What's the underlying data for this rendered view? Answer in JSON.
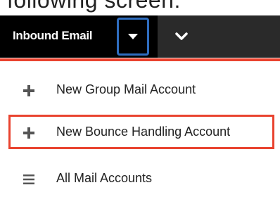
{
  "header": {
    "partial_title": "following screen:"
  },
  "navbar": {
    "module_title": "Inbound Email",
    "caret_icon": "caret-down-icon",
    "chevron_icon": "chevron-down-icon"
  },
  "menu": {
    "items": [
      {
        "label": "New Group Mail Account",
        "icon": "plus-icon"
      },
      {
        "label": "New Bounce Handling Account",
        "icon": "plus-icon"
      },
      {
        "label": "All Mail Accounts",
        "icon": "list-icon"
      }
    ]
  },
  "colors": {
    "accent": "#e9432f",
    "focus": "#2f6dbf",
    "navbar": "#000000"
  }
}
